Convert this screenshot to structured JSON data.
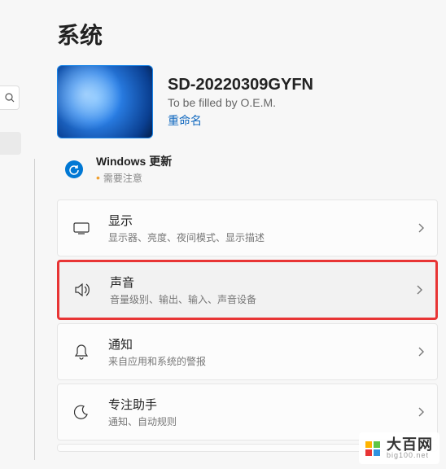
{
  "page_title": "系统",
  "device": {
    "name": "SD-20220309GYFN",
    "oem": "To be filled by O.E.M.",
    "rename_label": "重命名"
  },
  "update": {
    "title": "Windows 更新",
    "status": "需要注意"
  },
  "items": [
    {
      "title": "显示",
      "desc": "显示器、亮度、夜间模式、显示描述"
    },
    {
      "title": "声音",
      "desc": "音量级别、输出、输入、声音设备"
    },
    {
      "title": "通知",
      "desc": "来自应用和系统的警报"
    },
    {
      "title": "专注助手",
      "desc": "通知、自动规则"
    }
  ],
  "watermark": {
    "big": "大百网",
    "small": "big100.net"
  }
}
